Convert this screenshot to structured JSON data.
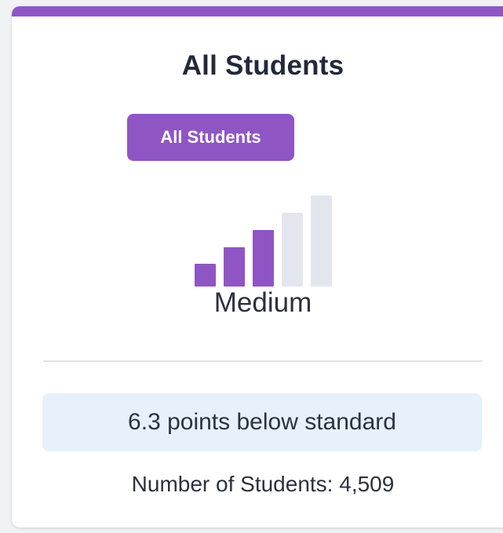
{
  "card": {
    "title": "All Students",
    "student_group_button": "All Students",
    "performance_level": {
      "label": "Medium",
      "filled_bars": 3,
      "total_bars": 5,
      "filled_color": "#9055c4",
      "empty_color": "#e4e6ee"
    },
    "status_text": "6.3 points below standard",
    "student_count_label": "Number of Students:",
    "student_count_value": "4,509"
  },
  "colors": {
    "accent": "#9055c4",
    "status_background": "#e6f1fb",
    "text": "#2c3140"
  }
}
